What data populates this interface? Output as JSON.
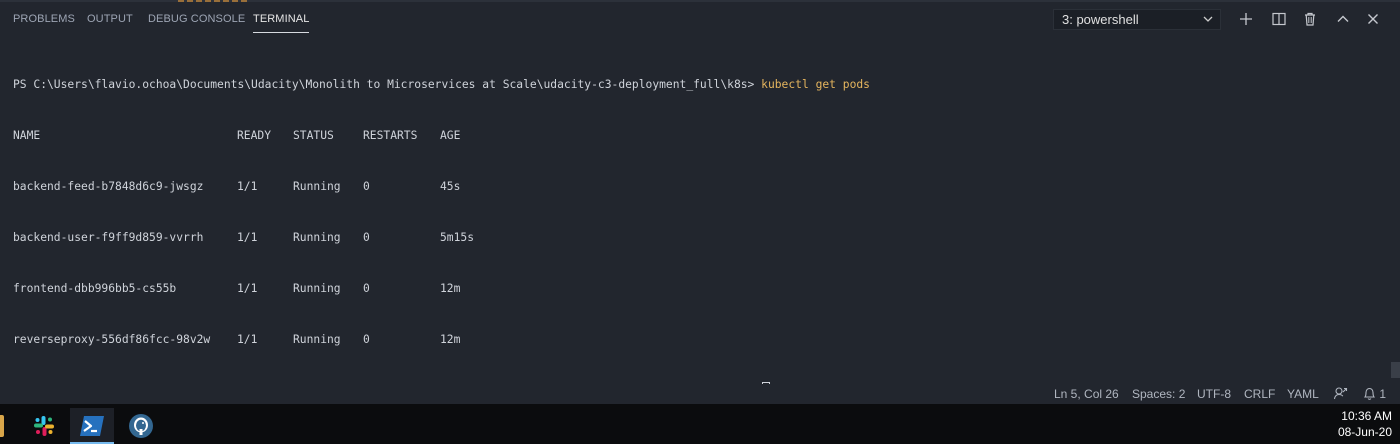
{
  "panel": {
    "tabs": [
      {
        "label": "PROBLEMS"
      },
      {
        "label": "OUTPUT"
      },
      {
        "label": "DEBUG CONSOLE"
      },
      {
        "label": "TERMINAL",
        "active": true
      }
    ],
    "terminal_select": {
      "value": "3: powershell"
    },
    "actions": [
      "plus-icon",
      "split-icon",
      "trash-icon",
      "chevron-up-icon",
      "close-icon"
    ]
  },
  "terminal": {
    "prompt": "PS C:\\Users\\flavio.ochoa\\Documents\\Udacity\\Monolith to Microservices at Scale\\udacity-c3-deployment_full\\k8s>",
    "command": "kubectl get pods",
    "table": {
      "headers": [
        "NAME",
        "READY",
        "STATUS",
        "RESTARTS",
        "AGE"
      ],
      "rows": [
        [
          "backend-feed-b7848d6c9-jwsgz",
          "1/1",
          "Running",
          "0",
          "45s"
        ],
        [
          "backend-user-f9ff9d859-vvrrh",
          "1/1",
          "Running",
          "0",
          "5m15s"
        ],
        [
          "frontend-dbb996bb5-cs55b",
          "1/1",
          "Running",
          "0",
          "12m"
        ],
        [
          "reverseproxy-556df86fcc-98v2w",
          "1/1",
          "Running",
          "0",
          "12m"
        ]
      ]
    },
    "colors": {
      "command": "#e5b55e",
      "text": "#cfd3da",
      "background": "#22262e"
    }
  },
  "statusbar": {
    "position": "Ln 5, Col 26",
    "spaces": "Spaces: 2",
    "encoding": "UTF-8",
    "eol": "CRLF",
    "language": "YAML",
    "notifications": "1"
  },
  "taskbar": {
    "apps": [
      "slack-icon",
      "powershell-icon",
      "postgres-icon"
    ],
    "time": "10:36 AM",
    "date": "08-Jun-20"
  }
}
